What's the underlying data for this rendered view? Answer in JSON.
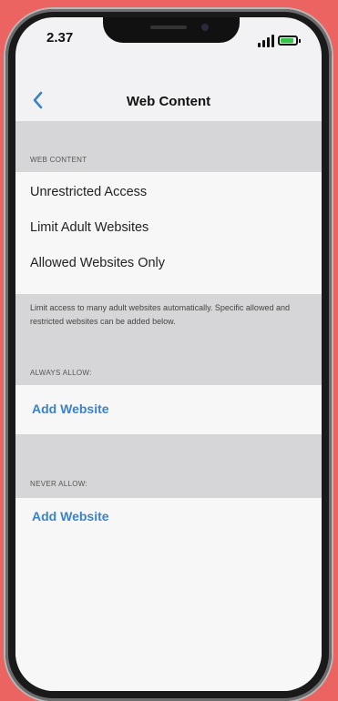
{
  "status": {
    "time": "2.37"
  },
  "nav": {
    "title": "Web Content"
  },
  "web_content": {
    "header": "WEB CONTENT",
    "options": [
      "Unrestricted Access",
      "Limit Adult Websites",
      "Allowed Websites Only"
    ],
    "footer": "Limit access to many adult websites automatically. Specific allowed and restricted websites can be added below."
  },
  "always_allow": {
    "header": "ALWAYS ALLOW:",
    "action": "Add Website"
  },
  "never_allow": {
    "header": "NEVER ALLOW:",
    "action": "Add Website"
  },
  "colors": {
    "background": "#ec6461",
    "link": "#3a82c9",
    "battery": "#38c24a"
  }
}
